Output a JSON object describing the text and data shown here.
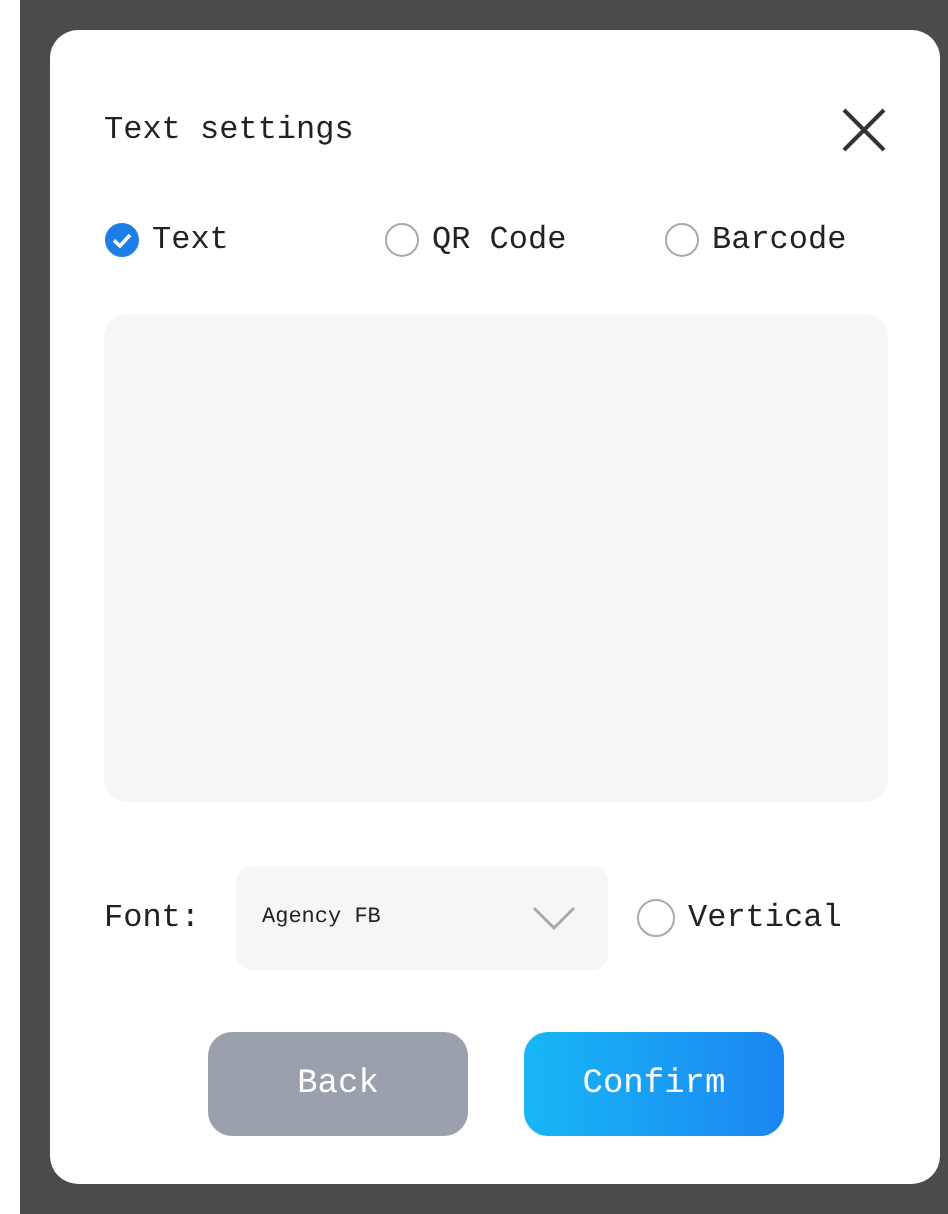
{
  "dialog": {
    "title": "Text settings"
  },
  "modes": [
    {
      "label": "Text",
      "selected": true
    },
    {
      "label": "QR Code",
      "selected": false
    },
    {
      "label": "Barcode",
      "selected": false
    }
  ],
  "font": {
    "label": "Font:",
    "value": "Agency FB"
  },
  "vertical": {
    "label": "Vertical",
    "checked": false
  },
  "buttons": [
    {
      "label": "Back",
      "kind": "secondary"
    },
    {
      "label": "Confirm",
      "kind": "primary"
    }
  ]
}
